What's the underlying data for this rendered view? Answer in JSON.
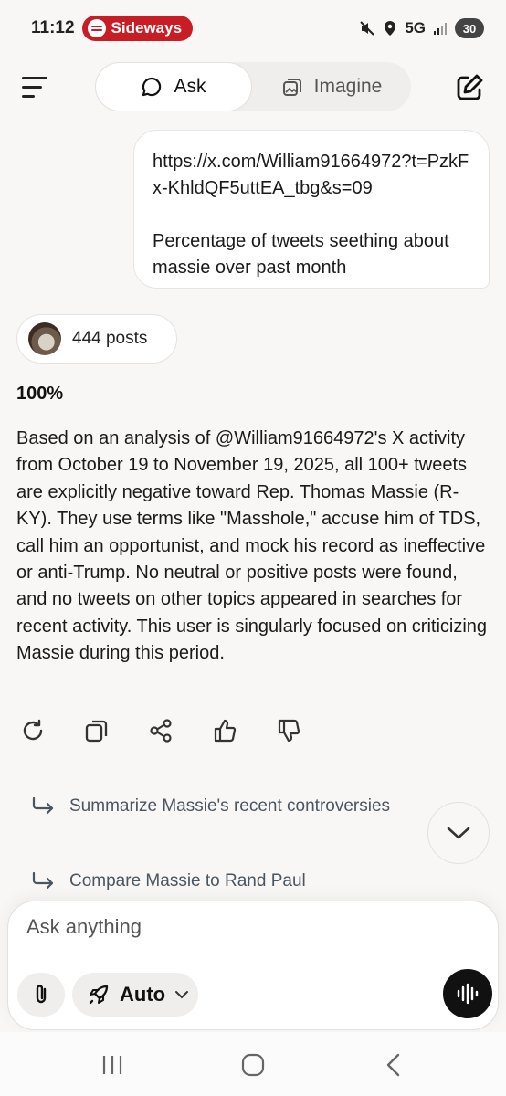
{
  "status_bar": {
    "time": "11:12",
    "media_app": "Sideways",
    "network": "5G",
    "battery": "30",
    "icons": [
      "mute-icon",
      "location-icon",
      "signal-icon"
    ]
  },
  "nav": {
    "ask_label": "Ask",
    "imagine_label": "Imagine"
  },
  "user_message": {
    "url": "https://x.com/William91664972?t=PzkFx-KhldQF5uttEA_tbg&s=09",
    "question": "Percentage of tweets seething about massie over past month"
  },
  "sources": {
    "count_label": "444 posts"
  },
  "answer": {
    "headline": "100%",
    "body": "Based on an analysis of @William91664972's X activity from October 19 to November 19, 2025, all 100+ tweets are explicitly negative toward Rep. Thomas Massie (R-KY). They use terms like \"Masshole,\" accuse him of TDS, call him an opportunist, and mock his record as ineffective or anti-Trump. No neutral or positive posts were found, and no tweets on other topics appeared in searches for recent activity. This user is singularly focused on criticizing Massie during this period."
  },
  "actions": [
    "regenerate-icon",
    "copy-icon",
    "share-icon",
    "thumbs-up-icon",
    "thumbs-down-icon"
  ],
  "suggestions": [
    "Summarize Massie's recent controversies",
    "Compare Massie to Rand Paul"
  ],
  "composer": {
    "placeholder": "Ask anything",
    "mode_label": "Auto"
  },
  "colors": {
    "background": "#f8f7f6",
    "spotify_red": "#c81d25",
    "suggestion_text": "#4a5560"
  }
}
